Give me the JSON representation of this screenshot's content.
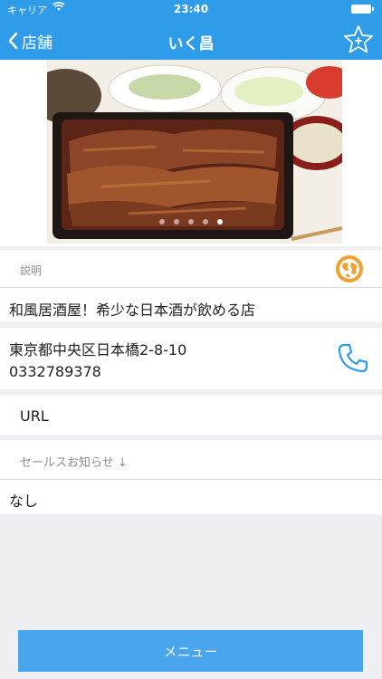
{
  "status_bar": {
    "carrier": "キャリア",
    "time": "23:40"
  },
  "nav": {
    "back_label": "店舗",
    "title": "いく昌"
  },
  "carousel": {
    "slide_count": 5,
    "active_index": 4
  },
  "description": {
    "label": "説明",
    "text": "和風居酒屋！希少な日本酒が飲める店"
  },
  "contact": {
    "address": "東京都中央区日本橋2-8-10",
    "phone": "0332789378"
  },
  "url": {
    "label": "URL"
  },
  "sales": {
    "label": "セールスお知らせ ↓",
    "text": "なし"
  },
  "menu_button": {
    "label": "メニュー"
  },
  "colors": {
    "nav": "#2f9ce9",
    "button": "#4aa5ef",
    "globe": "#f0a030",
    "phone": "#2f9ce9"
  }
}
